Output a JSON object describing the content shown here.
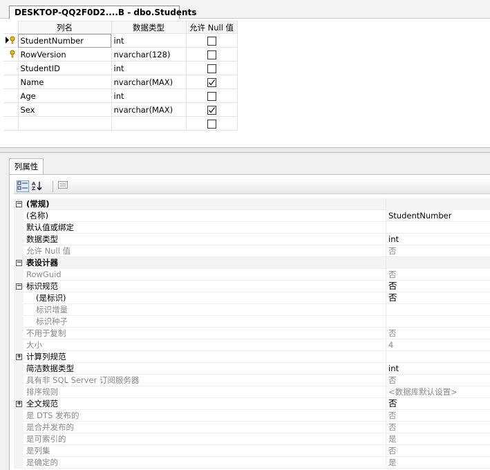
{
  "document_tab": {
    "title": "DESKTOP-QQ2F0D2....B - dbo.Students"
  },
  "grid": {
    "headers": [
      "列名",
      "数据类型",
      "允许 Null 值"
    ],
    "rows": [
      {
        "name": "StudentNumber",
        "type": "int",
        "allow_null": false,
        "marker": "current-primary-key"
      },
      {
        "name": "RowVersion",
        "type": "nvarchar(128)",
        "allow_null": false,
        "marker": "primary-key"
      },
      {
        "name": "StudentID",
        "type": "int",
        "allow_null": false,
        "marker": ""
      },
      {
        "name": "Name",
        "type": "nvarchar(MAX)",
        "allow_null": true,
        "marker": ""
      },
      {
        "name": "Age",
        "type": "int",
        "allow_null": false,
        "marker": ""
      },
      {
        "name": "Sex",
        "type": "nvarchar(MAX)",
        "allow_null": true,
        "marker": ""
      },
      {
        "name": "",
        "type": "",
        "allow_null": false,
        "marker": ""
      }
    ]
  },
  "properties": {
    "tab_label": "列属性",
    "rows": [
      {
        "label": "(常规)",
        "value": "",
        "kind": "category",
        "expander": "⊟",
        "indent": 0,
        "dim": false
      },
      {
        "label": "(名称)",
        "value": "StudentNumber",
        "kind": "item",
        "expander": "",
        "indent": 1,
        "dim": false
      },
      {
        "label": "默认值或绑定",
        "value": "",
        "kind": "item",
        "expander": "",
        "indent": 1,
        "dim": false
      },
      {
        "label": "数据类型",
        "value": "int",
        "kind": "item",
        "expander": "",
        "indent": 1,
        "dim": false
      },
      {
        "label": "允许 Null 值",
        "value": "否",
        "kind": "item",
        "expander": "",
        "indent": 1,
        "dim": true
      },
      {
        "label": "表设计器",
        "value": "",
        "kind": "category",
        "expander": "⊟",
        "indent": 0,
        "dim": false
      },
      {
        "label": "RowGuid",
        "value": "否",
        "kind": "item",
        "expander": "",
        "indent": 1,
        "dim": true
      },
      {
        "label": "标识规范",
        "value": "否",
        "kind": "item",
        "expander": "⊟",
        "indent": 1,
        "dim": false,
        "bigv": true
      },
      {
        "label": "(是标识)",
        "value": "否",
        "kind": "item",
        "expander": "",
        "indent": 2,
        "dim": false,
        "bigv": true
      },
      {
        "label": "标识增量",
        "value": "",
        "kind": "item",
        "expander": "",
        "indent": 2,
        "dim": true
      },
      {
        "label": "标识种子",
        "value": "",
        "kind": "item",
        "expander": "",
        "indent": 2,
        "dim": true
      },
      {
        "label": "不用于复制",
        "value": "否",
        "kind": "item",
        "expander": "",
        "indent": 1,
        "dim": true
      },
      {
        "label": "大小",
        "value": "4",
        "kind": "item",
        "expander": "",
        "indent": 1,
        "dim": true
      },
      {
        "label": "计算列规范",
        "value": "",
        "kind": "item",
        "expander": "⊞",
        "indent": 1,
        "dim": false
      },
      {
        "label": "简洁数据类型",
        "value": "int",
        "kind": "item",
        "expander": "",
        "indent": 1,
        "dim": false
      },
      {
        "label": "具有非 SQL Server 订阅服务器",
        "value": "否",
        "kind": "item",
        "expander": "",
        "indent": 1,
        "dim": true
      },
      {
        "label": "排序规则",
        "value": "<数据库默认设置>",
        "kind": "item",
        "expander": "",
        "indent": 1,
        "dim": true
      },
      {
        "label": "全文规范",
        "value": "否",
        "kind": "item",
        "expander": "⊞",
        "indent": 1,
        "dim": false,
        "bigv": true
      },
      {
        "label": "是 DTS 发布的",
        "value": "否",
        "kind": "item",
        "expander": "",
        "indent": 1,
        "dim": true
      },
      {
        "label": "是合并发布的",
        "value": "否",
        "kind": "item",
        "expander": "",
        "indent": 1,
        "dim": true
      },
      {
        "label": "是可索引的",
        "value": "是",
        "kind": "item",
        "expander": "",
        "indent": 1,
        "dim": true
      },
      {
        "label": "是列集",
        "value": "否",
        "kind": "item",
        "expander": "",
        "indent": 1,
        "dim": true
      },
      {
        "label": "是确定的",
        "value": "是",
        "kind": "item",
        "expander": "",
        "indent": 1,
        "dim": true
      }
    ]
  },
  "toolbar": {
    "categorized_icon": "categorized-icon",
    "alphabetical_icon": "alphabetical-sort-icon",
    "property_pages_icon": "property-pages-icon"
  }
}
